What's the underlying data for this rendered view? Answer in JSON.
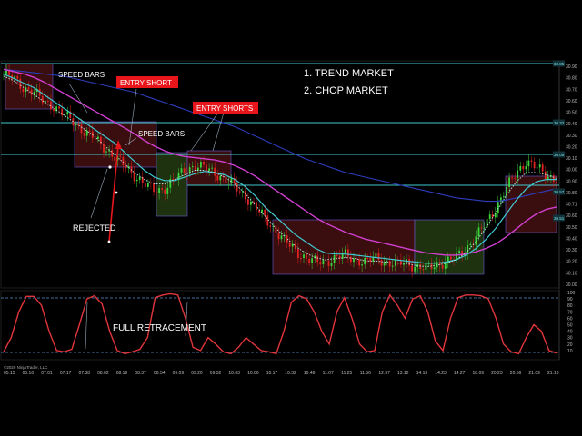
{
  "colors": {
    "background": "#000000",
    "price_up": "#3bd43b",
    "price_down": "#e02222",
    "ema_fast": "#b8ecec",
    "ema_mid": "#40c8d0",
    "ema_slow": "#d13fd1",
    "ema_long": "#2d3dbb",
    "level_line": "#40c8d0",
    "trend_box": "#3a0e0e",
    "chop_box": "#1e3210",
    "oscillator": "#e0353b",
    "osc_level": "#5b8fd0",
    "annotation": "#ffffff",
    "tag": "#e8151b"
  },
  "annotations": {
    "list_1": "1. TREND MARKET",
    "list_2": "2. CHOP MARKET",
    "speed_bars_1": "SPEED BARS",
    "speed_bars_2": "SPEED BARS",
    "entry_short": "ENTRY SHORT",
    "entry_shorts": "ENTRY SHORTS",
    "rejected": "REJECTED",
    "full_retracement": "FULL RETRACEMENT"
  },
  "copyright": "©2020 NinjaTrader, LLC",
  "chart_data": {
    "type": "line",
    "series_kind": "candlestick price chart with moving averages and oscillator panel",
    "x_tick_labels": [
      "05:15",
      "05:10",
      "07:01",
      "07:17",
      "07:38",
      "08:02",
      "08:19",
      "08:37",
      "08:54",
      "09:09",
      "09:20",
      "09:32",
      "10:03",
      "10:06",
      "10:17",
      "10:32",
      "10:48",
      "11:07",
      "11:25",
      "11:56",
      "12:37",
      "13:12",
      "14:13",
      "14:23",
      "14:27",
      "18:09",
      "20:23",
      "20:56",
      "21:09",
      "21:16"
    ],
    "price_axis_labels": [
      "30.90",
      "30.80",
      "30.70",
      "30.60",
      "30.50",
      "30.40",
      "30.30",
      "30.20",
      "30.10",
      "30.00",
      "30.90",
      "30.80",
      "30.71",
      "30.60",
      "30.50",
      "30.40",
      "30.30",
      "30.20",
      "30.10",
      "30.00"
    ],
    "price_level_tags": [
      "30.85",
      "30.32",
      "30.05",
      "30.57",
      "30.51"
    ],
    "oscillator_axis_labels": [
      "100",
      "90",
      "80",
      "70",
      "60",
      "50",
      "40",
      "30",
      "20",
      "10"
    ],
    "oscillator_levels": [
      90,
      10
    ],
    "close_path": [
      30.86,
      30.82,
      30.74,
      30.7,
      30.62,
      30.58,
      30.5,
      30.44,
      30.36,
      30.3,
      30.22,
      30.14,
      30.06,
      29.98,
      29.9,
      29.84,
      29.86,
      29.94,
      30.02,
      30.06,
      30.04,
      30.0,
      29.94,
      29.88,
      29.8,
      29.7,
      29.6,
      29.5,
      29.4,
      29.32,
      29.26,
      29.22,
      29.22,
      29.26,
      29.28,
      29.24,
      29.22,
      29.26,
      29.22,
      29.2,
      29.22,
      29.18,
      29.16,
      29.2,
      29.22,
      29.26,
      29.34,
      29.44,
      29.56,
      29.7,
      29.86,
      30.0,
      30.1,
      30.04,
      29.98,
      29.94
    ],
    "ema_fast_path": [
      30.84,
      30.8,
      30.74,
      30.68,
      30.62,
      30.56,
      30.5,
      30.44,
      30.38,
      30.32,
      30.24,
      30.16,
      30.08,
      30.0,
      29.94,
      29.9,
      29.9,
      29.94,
      29.98,
      30.02,
      30.02,
      30.0,
      29.96,
      29.9,
      29.82,
      29.72,
      29.62,
      29.52,
      29.44,
      29.36,
      29.3,
      29.26,
      29.24,
      29.25,
      29.26,
      29.25,
      29.23,
      29.23,
      29.22,
      29.21,
      29.21,
      29.19,
      29.18,
      29.19,
      29.21,
      29.24,
      29.3,
      29.4,
      29.52,
      29.66,
      29.8,
      29.92,
      30.0,
      30.0,
      29.98,
      29.95
    ],
    "ema_mid_path": [
      30.86,
      30.82,
      30.78,
      30.74,
      30.68,
      30.62,
      30.56,
      30.5,
      30.44,
      30.38,
      30.32,
      30.26,
      30.18,
      30.1,
      30.02,
      29.96,
      29.93,
      29.93,
      29.96,
      29.99,
      30.01,
      30.0,
      29.98,
      29.94,
      29.88,
      29.8,
      29.7,
      29.62,
      29.54,
      29.46,
      29.4,
      29.34,
      29.3,
      29.29,
      29.29,
      29.28,
      29.27,
      29.26,
      29.25,
      29.24,
      29.23,
      29.22,
      29.21,
      29.21,
      29.22,
      29.24,
      29.28,
      29.34,
      29.42,
      29.52,
      29.64,
      29.76,
      29.86,
      29.92,
      29.94,
      29.94
    ],
    "ema_slow_path": [
      30.9,
      30.88,
      30.86,
      30.83,
      30.79,
      30.74,
      30.69,
      30.64,
      30.59,
      30.54,
      30.49,
      30.44,
      30.39,
      30.34,
      30.28,
      30.23,
      30.19,
      30.16,
      30.14,
      30.13,
      30.12,
      30.11,
      30.09,
      30.06,
      30.02,
      29.97,
      29.91,
      29.85,
      29.79,
      29.73,
      29.67,
      29.61,
      29.56,
      29.52,
      29.48,
      29.45,
      29.42,
      29.4,
      29.38,
      29.36,
      29.34,
      29.32,
      29.3,
      29.29,
      29.28,
      29.28,
      29.29,
      29.31,
      29.34,
      29.38,
      29.44,
      29.51,
      29.58,
      29.64,
      29.68,
      29.7
    ],
    "ema_long_path": [
      30.9,
      30.89,
      30.88,
      30.87,
      30.86,
      30.85,
      30.84,
      30.82,
      30.8,
      30.78,
      30.76,
      30.74,
      30.72,
      30.7,
      30.67,
      30.64,
      30.61,
      30.58,
      30.55,
      30.52,
      30.49,
      30.46,
      30.43,
      30.4,
      30.36,
      30.32,
      30.28,
      30.24,
      30.2,
      30.16,
      30.12,
      30.09,
      30.06,
      30.03,
      30.0,
      29.98,
      29.96,
      29.94,
      29.92,
      29.9,
      29.88,
      29.86,
      29.84,
      29.82,
      29.8,
      29.78,
      29.77,
      29.76,
      29.75,
      29.75,
      29.76,
      29.78,
      29.8,
      29.82,
      29.84,
      29.86
    ],
    "oscillator_path": [
      8,
      30,
      70,
      94,
      94,
      80,
      40,
      10,
      8,
      12,
      50,
      90,
      95,
      82,
      40,
      10,
      5,
      8,
      12,
      30,
      92,
      96,
      98,
      96,
      60,
      15,
      10,
      30,
      20,
      8,
      5,
      15,
      30,
      20,
      10,
      8,
      5,
      40,
      85,
      95,
      90,
      70,
      40,
      20,
      70,
      92,
      60,
      20,
      8,
      10,
      70,
      96,
      80,
      60,
      90,
      95,
      70,
      25,
      10,
      60,
      92,
      96,
      96,
      95,
      90,
      60,
      20,
      8,
      5,
      30,
      50,
      40,
      10,
      6
    ]
  }
}
